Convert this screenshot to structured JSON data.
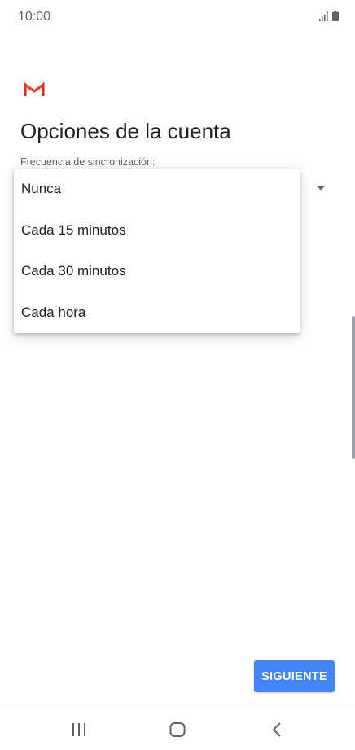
{
  "status_bar": {
    "time": "10:00"
  },
  "account_options": {
    "title": "Opciones de la cuenta",
    "sync_frequency_label": "Frecuencia de sincronización:",
    "sync_options": [
      {
        "label": "Nunca"
      },
      {
        "label": "Cada 15 minutos"
      },
      {
        "label": "Cada 30 minutos"
      },
      {
        "label": "Cada hora"
      }
    ]
  },
  "actions": {
    "next_label": "SIGUIENTE"
  },
  "colors": {
    "accent": "#4285f4",
    "gmail_red": "#d93025",
    "text_primary": "#202124",
    "text_secondary": "#5f6368"
  },
  "icons": {
    "logo": "gmail-logo",
    "dropdown": "dropdown-arrow-icon",
    "nav_recents": "recents-icon",
    "nav_home": "home-icon",
    "nav_back": "back-icon"
  }
}
